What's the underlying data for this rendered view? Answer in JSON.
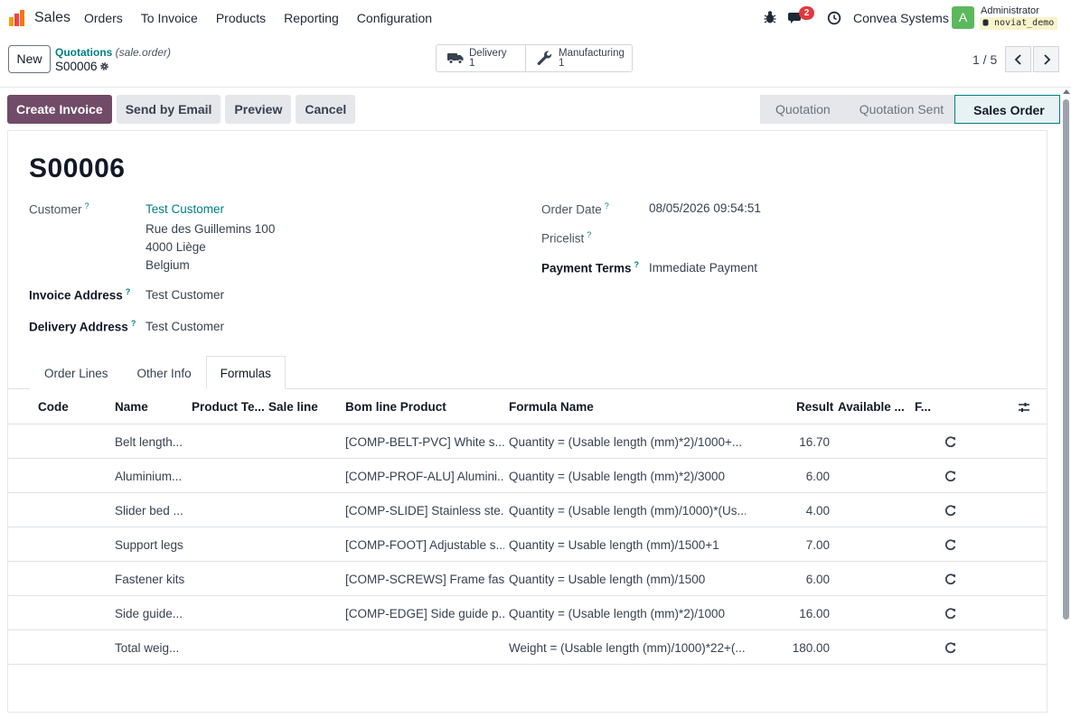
{
  "navbar": {
    "app_name": "Sales",
    "menu": [
      "Orders",
      "To Invoice",
      "Products",
      "Reporting",
      "Configuration"
    ],
    "chat_count": "2",
    "company": "Convea Systems",
    "avatar_letter": "A",
    "user_name": "Administrator",
    "database": "noviat_demo"
  },
  "control": {
    "new_label": "New",
    "breadcrumb_link": "Quotations",
    "breadcrumb_model": "(sale.order)",
    "record": "S00006",
    "smart_buttons": [
      {
        "label": "Delivery",
        "value": "1",
        "icon": "truck-icon"
      },
      {
        "label": "Manufacturing",
        "value": "1",
        "icon": "wrench-icon"
      }
    ],
    "pager": "1 / 5"
  },
  "actions": {
    "create_invoice": "Create Invoice",
    "send_by_email": "Send by Email",
    "preview": "Preview",
    "cancel": "Cancel"
  },
  "status": {
    "stages": [
      "Quotation",
      "Quotation Sent",
      "Sales Order"
    ],
    "active": "Sales Order"
  },
  "form": {
    "title": "S00006",
    "customer_label": "Customer",
    "customer_name": "Test Customer",
    "customer_address": [
      "Rue des Guillemins 100",
      "4000 Liège",
      "Belgium"
    ],
    "invoice_address_label": "Invoice Address",
    "invoice_address": "Test Customer",
    "delivery_address_label": "Delivery Address",
    "delivery_address": "Test Customer",
    "order_date_label": "Order Date",
    "order_date": "08/05/2026 09:54:51",
    "pricelist_label": "Pricelist",
    "payment_terms_label": "Payment Terms",
    "payment_terms": "Immediate Payment",
    "help_mark": "?"
  },
  "tabs": [
    "Order Lines",
    "Other Info",
    "Formulas"
  ],
  "table": {
    "headers": {
      "code": "Code",
      "name": "Name",
      "product_template": "Product Te...",
      "sale_line": "Sale line",
      "bom_line_product": "Bom line Product",
      "formula_name": "Formula Name",
      "result": "Result",
      "available": "Available ...",
      "f": "F..."
    },
    "rows": [
      {
        "name": "Belt length...",
        "bom": "[COMP-BELT-PVC] White s...",
        "formula": "Quantity = (Usable length (mm)*2)/1000+...",
        "result": "16.70"
      },
      {
        "name": "Aluminium...",
        "bom": "[COMP-PROF-ALU] Alumini...",
        "formula": "Quantity = (Usable length (mm)*2)/3000",
        "result": "6.00"
      },
      {
        "name": "Slider bed ...",
        "bom": "[COMP-SLIDE] Stainless ste...",
        "formula": "Quantity = (Usable length (mm)/1000)*(Us...",
        "result": "4.00"
      },
      {
        "name": "Support legs",
        "bom": "[COMP-FOOT] Adjustable s...",
        "formula": "Quantity = Usable length (mm)/1500+1",
        "result": "7.00"
      },
      {
        "name": "Fastener kits",
        "bom": "[COMP-SCREWS] Frame fas...",
        "formula": "Quantity = Usable length (mm)/1500",
        "result": "6.00"
      },
      {
        "name": "Side guide...",
        "bom": "[COMP-EDGE] Side guide p...",
        "formula": "Quantity = (Usable length (mm)*2)/1000",
        "result": "16.00"
      },
      {
        "name": "Total weig...",
        "bom": "",
        "formula": "Weight = (Usable length (mm)/1000)*22+(...",
        "result": "180.00"
      }
    ]
  },
  "colors": {
    "brand": "#714b67",
    "link": "#017e84",
    "badge": "#e03a3e"
  }
}
